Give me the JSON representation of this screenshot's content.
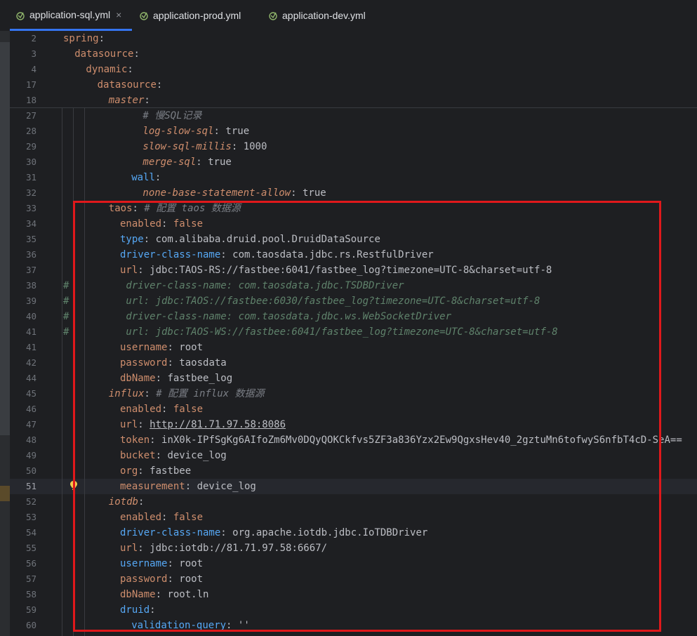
{
  "tabs": [
    {
      "label": "application-sql.yml",
      "active": true,
      "close": "×"
    },
    {
      "label": "application-prod.yml",
      "active": false
    },
    {
      "label": "application-dev.yml",
      "active": false
    }
  ],
  "colors": {
    "accent": "#3574f0",
    "highlight_box": "#e0181b",
    "keyword": "#cf8e6d",
    "key_blue": "#56a8f5"
  },
  "lines": [
    {
      "n": "2",
      "indent": 0,
      "key": "spring",
      "sep": ":",
      "value": "",
      "kstyle": "k"
    },
    {
      "n": "3",
      "indent": 1,
      "key": "datasource",
      "sep": ":",
      "value": "",
      "kstyle": "k"
    },
    {
      "n": "4",
      "indent": 2,
      "key": "dynamic",
      "sep": ":",
      "value": "",
      "kstyle": "k"
    },
    {
      "n": "17",
      "indent": 3,
      "key": "datasource",
      "sep": ":",
      "value": "",
      "kstyle": "k"
    },
    {
      "n": "18",
      "indent": 4,
      "key": "master",
      "sep": ":",
      "value": "",
      "kstyle": "ki"
    },
    {
      "n": "27",
      "indent": 7,
      "key": "",
      "sep": "",
      "value": "",
      "comment": "# 慢SQL记录"
    },
    {
      "n": "28",
      "indent": 7,
      "key": "log-slow-sql",
      "sep": ": ",
      "value": "true",
      "kstyle": "ki"
    },
    {
      "n": "29",
      "indent": 7,
      "key": "slow-sql-millis",
      "sep": ": ",
      "value": "1000",
      "kstyle": "ki"
    },
    {
      "n": "30",
      "indent": 7,
      "key": "merge-sql",
      "sep": ": ",
      "value": "true",
      "kstyle": "ki"
    },
    {
      "n": "31",
      "indent": 6,
      "key": "wall",
      "sep": ":",
      "value": "",
      "kstyle": "kb"
    },
    {
      "n": "32",
      "indent": 7,
      "key": "none-base-statement-allow",
      "sep": ": ",
      "value": "true",
      "kstyle": "ki"
    },
    {
      "n": "33",
      "indent": 4,
      "key": "taos",
      "sep": ": ",
      "value": "",
      "comment": "# 配置 taos 数据源",
      "kstyle": "k"
    },
    {
      "n": "34",
      "indent": 5,
      "key": "enabled",
      "sep": ": ",
      "value": "false",
      "vstyle": "k",
      "kstyle": "k"
    },
    {
      "n": "35",
      "indent": 5,
      "key": "type",
      "sep": ": ",
      "value": "com.alibaba.druid.pool.DruidDataSource",
      "kstyle": "kb"
    },
    {
      "n": "36",
      "indent": 5,
      "key": "driver-class-name",
      "sep": ": ",
      "value": "com.taosdata.jdbc.rs.RestfulDriver",
      "kstyle": "kb"
    },
    {
      "n": "37",
      "indent": 5,
      "key": "url",
      "sep": ": ",
      "value": "jdbc:TAOS-RS://fastbee:6041/fastbee_log?timezone=UTC-8&charset=utf-8",
      "kstyle": "k"
    },
    {
      "n": "38",
      "indent": 5,
      "hash": "#",
      "key": "",
      "sep": "",
      "value": "",
      "gcomment": " driver-class-name: com.taosdata.jdbc.TSDBDriver"
    },
    {
      "n": "39",
      "indent": 5,
      "hash": "#",
      "key": "",
      "sep": "",
      "value": "",
      "gcomment": " url: jdbc:TAOS://fastbee:6030/fastbee_log?timezone=UTC-8&charset=utf-8"
    },
    {
      "n": "40",
      "indent": 5,
      "hash": "#",
      "key": "",
      "sep": "",
      "value": "",
      "gcomment": " driver-class-name: com.taosdata.jdbc.ws.WebSocketDriver"
    },
    {
      "n": "41",
      "indent": 5,
      "hash": "#",
      "key": "",
      "sep": "",
      "value": "",
      "gcomment": " url: jdbc:TAOS-WS://fastbee:6041/fastbee_log?timezone=UTC-8&charset=utf-8"
    },
    {
      "n": "41",
      "indent": 5,
      "key": "username",
      "sep": ": ",
      "value": "root",
      "kstyle": "k"
    },
    {
      "n": "42",
      "indent": 5,
      "key": "password",
      "sep": ": ",
      "value": "taosdata",
      "kstyle": "k"
    },
    {
      "n": "44",
      "indent": 5,
      "key": "dbName",
      "sep": ": ",
      "value": "fastbee_log",
      "kstyle": "k"
    },
    {
      "n": "45",
      "indent": 4,
      "key": "influx",
      "sep": ": ",
      "value": "",
      "comment": "# 配置 influx 数据源",
      "kstyle": "ki"
    },
    {
      "n": "46",
      "indent": 5,
      "key": "enabled",
      "sep": ": ",
      "value": "false",
      "vstyle": "k",
      "kstyle": "k"
    },
    {
      "n": "47",
      "indent": 5,
      "key": "url",
      "sep": ": ",
      "value": "http://81.71.97.58:8086",
      "vstyle": "link",
      "kstyle": "k"
    },
    {
      "n": "48",
      "indent": 5,
      "key": "token",
      "sep": ": ",
      "value": "inX0k-IPfSgKg6AIfoZm6Mv0DQyQOKCkfvs5ZF3a836Yzx2Ew9QgxsHev40_2gztuMn6tofwyS6nfbT4cD-SeA==",
      "kstyle": "k"
    },
    {
      "n": "49",
      "indent": 5,
      "key": "bucket",
      "sep": ": ",
      "value": "device_log",
      "kstyle": "k"
    },
    {
      "n": "50",
      "indent": 5,
      "key": "org",
      "sep": ": ",
      "value": "fastbee",
      "kstyle": "k"
    },
    {
      "n": "51",
      "indent": 5,
      "key": "measurement",
      "sep": ": ",
      "value": "device_log",
      "kstyle": "k",
      "current": true
    },
    {
      "n": "52",
      "indent": 4,
      "key": "iotdb",
      "sep": ":",
      "value": "",
      "kstyle": "ki"
    },
    {
      "n": "53",
      "indent": 5,
      "key": "enabled",
      "sep": ": ",
      "value": "false",
      "vstyle": "k",
      "kstyle": "k"
    },
    {
      "n": "54",
      "indent": 5,
      "key": "driver-class-name",
      "sep": ": ",
      "value": "org.apache.iotdb.jdbc.IoTDBDriver",
      "kstyle": "kb"
    },
    {
      "n": "55",
      "indent": 5,
      "key": "url",
      "sep": ": ",
      "value": "jdbc:iotdb://81.71.97.58:6667/",
      "kstyle": "k"
    },
    {
      "n": "56",
      "indent": 5,
      "key": "username",
      "sep": ": ",
      "value": "root",
      "kstyle": "kb"
    },
    {
      "n": "57",
      "indent": 5,
      "key": "password",
      "sep": ": ",
      "value": "root",
      "kstyle": "k"
    },
    {
      "n": "58",
      "indent": 5,
      "key": "dbName",
      "sep": ": ",
      "value": "root.ln",
      "kstyle": "k"
    },
    {
      "n": "59",
      "indent": 5,
      "key": "druid",
      "sep": ":",
      "value": "",
      "kstyle": "kb"
    },
    {
      "n": "60",
      "indent": 6,
      "key": "validation-query",
      "sep": ": ",
      "value": "''",
      "kstyle": "kb"
    }
  ]
}
